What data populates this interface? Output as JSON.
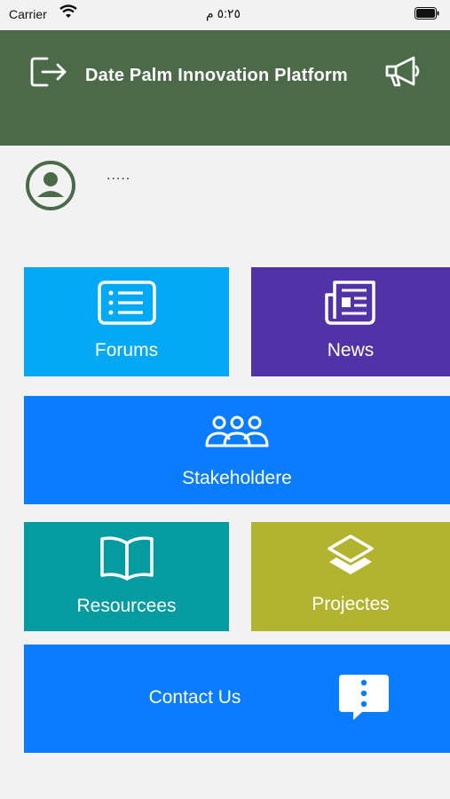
{
  "status_bar": {
    "carrier": "Carrier",
    "time": "٥:٢٥ م"
  },
  "header": {
    "title": "Date Palm Innovation Platform",
    "exit_icon": "exit-icon",
    "announce_icon": "megaphone-icon",
    "bg": "#4a6a48"
  },
  "profile": {
    "username": "....."
  },
  "tiles": [
    {
      "label": "Forums",
      "icon": "list-icon",
      "color": "#03a9f4"
    },
    {
      "label": "News",
      "icon": "newspaper-icon",
      "color": "#5233a7"
    },
    {
      "label": "Stakeholdere",
      "icon": "group-icon",
      "color": "#0a7cff"
    },
    {
      "label": "Resourcees",
      "icon": "book-icon",
      "color": "#049ca0"
    },
    {
      "label": "Projectes",
      "icon": "layers-icon",
      "color": "#b2b32e"
    },
    {
      "label": "Contact Us",
      "icon": "chat-icon",
      "color": "#0a7cff"
    }
  ]
}
